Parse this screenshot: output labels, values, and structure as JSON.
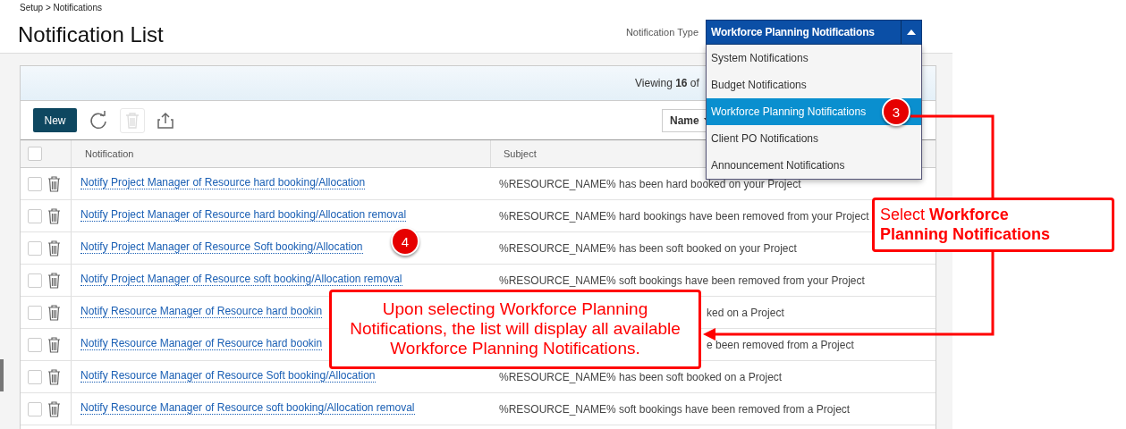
{
  "breadcrumb": "Setup > Notifications",
  "title": "Notification List",
  "notification_type": {
    "label": "Notification Type",
    "value": "Workforce Planning Notifications",
    "expanded": true,
    "options": [
      {
        "label": "System Notifications",
        "selected": false
      },
      {
        "label": "Budget Notifications",
        "selected": false
      },
      {
        "label": "Workforce Planning Notifications",
        "selected": true
      },
      {
        "label": "Client PO Notifications",
        "selected": false
      },
      {
        "label": "Announcement Notifications",
        "selected": false
      }
    ]
  },
  "viewing": {
    "label": "Viewing",
    "count": "16",
    "suffix": "of"
  },
  "toolbar": {
    "new_button": "New",
    "delete_disabled": true,
    "sort_field": "Name"
  },
  "table": {
    "select_all_checked": false,
    "columns": [
      "Notification",
      "Subject"
    ],
    "rows": [
      {
        "checked": false,
        "notification": "Notify Project Manager of Resource hard booking/Allocation",
        "subject": "%RESOURCE_NAME% has been hard booked on your Project",
        "kind": "full"
      },
      {
        "checked": false,
        "notification": "Notify Project Manager of Resource hard booking/Allocation removal",
        "subject": "%RESOURCE_NAME% hard bookings have been removed from your Project",
        "kind": "full"
      },
      {
        "checked": false,
        "notification": "Notify Project Manager of Resource Soft booking/Allocation",
        "subject": "%RESOURCE_NAME% has been soft booked on your Project",
        "kind": "full"
      },
      {
        "checked": false,
        "notification": "Notify Project Manager of Resource soft booking/Allocation removal",
        "subject": "%RESOURCE_NAME% soft bookings have been removed from your Project",
        "kind": "full"
      },
      {
        "checked": false,
        "notification": "Notify Resource Manager of Resource hard bookin",
        "subject": "ked on a Project",
        "kind": "covered"
      },
      {
        "checked": false,
        "notification": "Notify Resource Manager of Resource hard bookin",
        "subject": "e been removed from a Project",
        "kind": "covered"
      },
      {
        "checked": false,
        "notification": "Notify Resource Manager of Resource Soft booking/Allocation",
        "subject": "%RESOURCE_NAME% has been soft booked on a Project",
        "kind": "full"
      },
      {
        "checked": false,
        "notification": "Notify Resource Manager of Resource soft booking/Allocation removal",
        "subject": "%RESOURCE_NAME% soft bookings have been removed from a Project",
        "kind": "full"
      }
    ]
  },
  "annotations": {
    "badges": [
      {
        "number": "3"
      },
      {
        "number": "4"
      }
    ],
    "callouts": [
      {
        "text": "Select **Workforce Planning Notifications**"
      },
      {
        "text": "Upon selecting Workforce Planning Notifications, the list will display all available Workforce Planning Notifications."
      }
    ]
  }
}
